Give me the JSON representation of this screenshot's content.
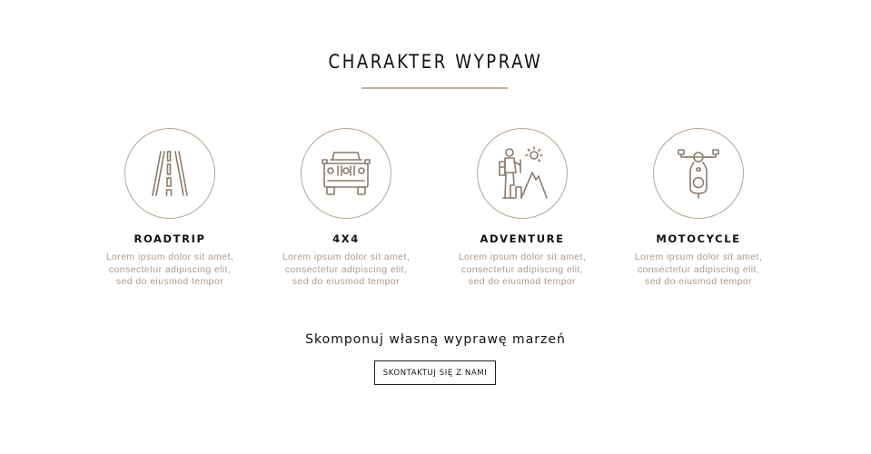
{
  "section": {
    "title": "CHARAKTER WYPRAW"
  },
  "features": [
    {
      "title": "ROADTRIP",
      "icon": "road-icon",
      "text": [
        "Lorem ipsum dolor sit amet,",
        "consectetur adipiscing elit,",
        "sed do eiusmod tempor"
      ]
    },
    {
      "title": "4X4",
      "icon": "offroad-vehicle-icon",
      "text": [
        "Lorem ipsum dolor sit amet,",
        "consectetur adipiscing elit,",
        "sed do eiusmod tempor"
      ]
    },
    {
      "title": "ADVENTURE",
      "icon": "hiker-icon",
      "text": [
        "Lorem ipsum dolor sit amet,",
        "consectetur adipiscing elit,",
        "sed do eiusmod tempor"
      ]
    },
    {
      "title": "MOTOCYCLE",
      "icon": "scooter-icon",
      "text": [
        "Lorem ipsum dolor sit amet,",
        "consectetur adipiscing elit,",
        "sed do eiusmod tempor"
      ]
    }
  ],
  "cta": {
    "text": "Skomponuj własną wyprawę marzeń",
    "button_label": "SKONTAKTUJ SIĘ Z NAMI"
  },
  "colors": {
    "accent": "#c8ae94",
    "icon_stroke": "#8c7b6b",
    "body_text": "#b09a85"
  }
}
